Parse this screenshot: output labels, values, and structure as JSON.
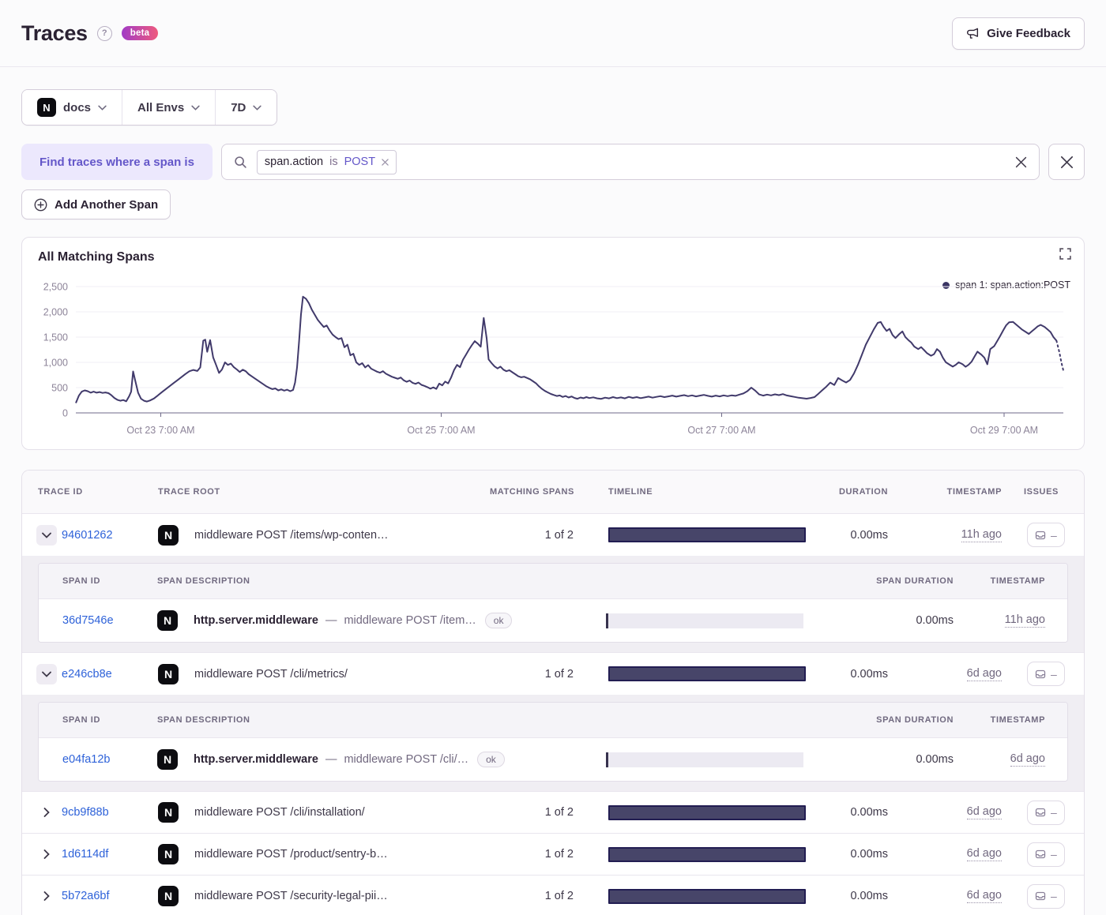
{
  "header": {
    "title": "Traces",
    "help_glyph": "?",
    "beta_label": "beta",
    "feedback_label": "Give Feedback"
  },
  "filters": {
    "project": "docs",
    "env": "All Envs",
    "period": "7D"
  },
  "brand": {
    "project_icon_letter": "N"
  },
  "search": {
    "label": "Find traces where a span is",
    "token_key": "span.action",
    "token_op": "is",
    "token_value": "POST"
  },
  "actions": {
    "add_span_label": "Add Another Span"
  },
  "chart": {
    "title": "All Matching Spans",
    "legend": "span 1: span.action:POST"
  },
  "chart_data": {
    "type": "line",
    "title": "All Matching Spans",
    "series_name": "span 1: span.action:POST",
    "line_color": "#413a6b",
    "ylim": [
      0,
      2500
    ],
    "grid": true,
    "legend_position": "top-right",
    "yticks": [
      {
        "v": 0,
        "label": "0"
      },
      {
        "v": 500,
        "label": "500"
      },
      {
        "v": 1000,
        "label": "1,000"
      },
      {
        "v": 1500,
        "label": "1,500"
      },
      {
        "v": 2000,
        "label": "2,000"
      },
      {
        "v": 2500,
        "label": "2,500"
      }
    ],
    "xticks": [
      {
        "pos": 0.086,
        "label": "Oct 23 7:00 AM"
      },
      {
        "pos": 0.37,
        "label": "Oct 25 7:00 AM"
      },
      {
        "pos": 0.654,
        "label": "Oct 27 7:00 AM"
      },
      {
        "pos": 0.94,
        "label": "Oct 29 7:00 AM"
      }
    ],
    "points": [
      [
        0.0,
        195
      ],
      [
        0.003,
        340
      ],
      [
        0.006,
        420
      ],
      [
        0.009,
        445
      ],
      [
        0.012,
        430
      ],
      [
        0.015,
        400
      ],
      [
        0.018,
        420
      ],
      [
        0.021,
        400
      ],
      [
        0.024,
        412
      ],
      [
        0.027,
        395
      ],
      [
        0.03,
        405
      ],
      [
        0.033,
        390
      ],
      [
        0.036,
        350
      ],
      [
        0.039,
        295
      ],
      [
        0.042,
        260
      ],
      [
        0.045,
        240
      ],
      [
        0.048,
        255
      ],
      [
        0.051,
        230
      ],
      [
        0.054,
        330
      ],
      [
        0.056,
        420
      ],
      [
        0.058,
        820
      ],
      [
        0.06,
        650
      ],
      [
        0.063,
        400
      ],
      [
        0.066,
        280
      ],
      [
        0.069,
        240
      ],
      [
        0.072,
        225
      ],
      [
        0.075,
        245
      ],
      [
        0.079,
        285
      ],
      [
        0.083,
        345
      ],
      [
        0.087,
        410
      ],
      [
        0.091,
        470
      ],
      [
        0.095,
        530
      ],
      [
        0.099,
        590
      ],
      [
        0.103,
        650
      ],
      [
        0.107,
        710
      ],
      [
        0.111,
        770
      ],
      [
        0.115,
        825
      ],
      [
        0.119,
        850
      ],
      [
        0.123,
        830
      ],
      [
        0.126,
        900
      ],
      [
        0.129,
        1430
      ],
      [
        0.131,
        1450
      ],
      [
        0.133,
        1210
      ],
      [
        0.136,
        1440
      ],
      [
        0.139,
        1100
      ],
      [
        0.142,
        950
      ],
      [
        0.145,
        790
      ],
      [
        0.148,
        860
      ],
      [
        0.151,
        1000
      ],
      [
        0.154,
        950
      ],
      [
        0.157,
        975
      ],
      [
        0.16,
        905
      ],
      [
        0.163,
        860
      ],
      [
        0.166,
        810
      ],
      [
        0.169,
        855
      ],
      [
        0.172,
        825
      ],
      [
        0.175,
        765
      ],
      [
        0.178,
        725
      ],
      [
        0.181,
        685
      ],
      [
        0.184,
        645
      ],
      [
        0.187,
        605
      ],
      [
        0.19,
        565
      ],
      [
        0.193,
        525
      ],
      [
        0.196,
        495
      ],
      [
        0.199,
        470
      ],
      [
        0.202,
        485
      ],
      [
        0.205,
        445
      ],
      [
        0.208,
        465
      ],
      [
        0.211,
        440
      ],
      [
        0.214,
        460
      ],
      [
        0.217,
        430
      ],
      [
        0.22,
        455
      ],
      [
        0.222,
        600
      ],
      [
        0.224,
        900
      ],
      [
        0.226,
        1400
      ],
      [
        0.228,
        1950
      ],
      [
        0.23,
        2300
      ],
      [
        0.233,
        2260
      ],
      [
        0.236,
        2170
      ],
      [
        0.239,
        2040
      ],
      [
        0.242,
        1940
      ],
      [
        0.245,
        1840
      ],
      [
        0.248,
        1770
      ],
      [
        0.251,
        1700
      ],
      [
        0.254,
        1730
      ],
      [
        0.257,
        1630
      ],
      [
        0.26,
        1550
      ],
      [
        0.263,
        1500
      ],
      [
        0.266,
        1460
      ],
      [
        0.269,
        1480
      ],
      [
        0.272,
        1300
      ],
      [
        0.275,
        1350
      ],
      [
        0.278,
        1140
      ],
      [
        0.281,
        1170
      ],
      [
        0.284,
        1000
      ],
      [
        0.287,
        950
      ],
      [
        0.29,
        985
      ],
      [
        0.293,
        900
      ],
      [
        0.296,
        945
      ],
      [
        0.299,
        875
      ],
      [
        0.302,
        845
      ],
      [
        0.305,
        815
      ],
      [
        0.308,
        795
      ],
      [
        0.311,
        825
      ],
      [
        0.314,
        775
      ],
      [
        0.317,
        745
      ],
      [
        0.32,
        715
      ],
      [
        0.323,
        695
      ],
      [
        0.326,
        675
      ],
      [
        0.329,
        700
      ],
      [
        0.332,
        645
      ],
      [
        0.335,
        615
      ],
      [
        0.338,
        640
      ],
      [
        0.341,
        595
      ],
      [
        0.344,
        575
      ],
      [
        0.347,
        600
      ],
      [
        0.35,
        555
      ],
      [
        0.353,
        535
      ],
      [
        0.356,
        510
      ],
      [
        0.359,
        480
      ],
      [
        0.362,
        505
      ],
      [
        0.365,
        475
      ],
      [
        0.368,
        580
      ],
      [
        0.371,
        545
      ],
      [
        0.374,
        620
      ],
      [
        0.377,
        585
      ],
      [
        0.38,
        700
      ],
      [
        0.383,
        850
      ],
      [
        0.386,
        950
      ],
      [
        0.389,
        905
      ],
      [
        0.392,
        1050
      ],
      [
        0.395,
        1150
      ],
      [
        0.398,
        1250
      ],
      [
        0.401,
        1340
      ],
      [
        0.404,
        1420
      ],
      [
        0.407,
        1370
      ],
      [
        0.41,
        1310
      ],
      [
        0.413,
        1880
      ],
      [
        0.416,
        1480
      ],
      [
        0.418,
        1060
      ],
      [
        0.421,
        985
      ],
      [
        0.424,
        920
      ],
      [
        0.427,
        880
      ],
      [
        0.43,
        915
      ],
      [
        0.433,
        855
      ],
      [
        0.436,
        825
      ],
      [
        0.439,
        845
      ],
      [
        0.442,
        805
      ],
      [
        0.445,
        765
      ],
      [
        0.448,
        725
      ],
      [
        0.451,
        705
      ],
      [
        0.454,
        715
      ],
      [
        0.457,
        690
      ],
      [
        0.46,
        665
      ],
      [
        0.463,
        625
      ],
      [
        0.466,
        585
      ],
      [
        0.469,
        525
      ],
      [
        0.472,
        475
      ],
      [
        0.475,
        435
      ],
      [
        0.478,
        405
      ],
      [
        0.481,
        375
      ],
      [
        0.484,
        355
      ],
      [
        0.487,
        335
      ],
      [
        0.49,
        345
      ],
      [
        0.493,
        315
      ],
      [
        0.496,
        335
      ],
      [
        0.499,
        305
      ],
      [
        0.502,
        325
      ],
      [
        0.505,
        295
      ],
      [
        0.508,
        280
      ],
      [
        0.511,
        305
      ],
      [
        0.514,
        290
      ],
      [
        0.517,
        312
      ],
      [
        0.52,
        293
      ],
      [
        0.524,
        308
      ],
      [
        0.528,
        288
      ],
      [
        0.532,
        278
      ],
      [
        0.536,
        302
      ],
      [
        0.54,
        287
      ],
      [
        0.544,
        312
      ],
      [
        0.548,
        292
      ],
      [
        0.552,
        307
      ],
      [
        0.556,
        287
      ],
      [
        0.56,
        317
      ],
      [
        0.564,
        297
      ],
      [
        0.568,
        312
      ],
      [
        0.572,
        292
      ],
      [
        0.576,
        307
      ],
      [
        0.58,
        322
      ],
      [
        0.584,
        302
      ],
      [
        0.588,
        317
      ],
      [
        0.592,
        332
      ],
      [
        0.596,
        312
      ],
      [
        0.6,
        327
      ],
      [
        0.604,
        342
      ],
      [
        0.608,
        322
      ],
      [
        0.612,
        337
      ],
      [
        0.616,
        352
      ],
      [
        0.62,
        332
      ],
      [
        0.624,
        347
      ],
      [
        0.628,
        327
      ],
      [
        0.632,
        342
      ],
      [
        0.636,
        357
      ],
      [
        0.64,
        337
      ],
      [
        0.644,
        322
      ],
      [
        0.648,
        342
      ],
      [
        0.652,
        327
      ],
      [
        0.656,
        347
      ],
      [
        0.66,
        332
      ],
      [
        0.664,
        347
      ],
      [
        0.668,
        337
      ],
      [
        0.672,
        362
      ],
      [
        0.676,
        385
      ],
      [
        0.68,
        430
      ],
      [
        0.684,
        500
      ],
      [
        0.688,
        440
      ],
      [
        0.692,
        365
      ],
      [
        0.696,
        342
      ],
      [
        0.7,
        362
      ],
      [
        0.704,
        347
      ],
      [
        0.708,
        367
      ],
      [
        0.712,
        352
      ],
      [
        0.716,
        372
      ],
      [
        0.72,
        345
      ],
      [
        0.724,
        330
      ],
      [
        0.728,
        315
      ],
      [
        0.732,
        300
      ],
      [
        0.736,
        290
      ],
      [
        0.74,
        282
      ],
      [
        0.744,
        295
      ],
      [
        0.748,
        312
      ],
      [
        0.752,
        380
      ],
      [
        0.756,
        452
      ],
      [
        0.76,
        520
      ],
      [
        0.764,
        600
      ],
      [
        0.768,
        552
      ],
      [
        0.772,
        690
      ],
      [
        0.776,
        642
      ],
      [
        0.78,
        602
      ],
      [
        0.784,
        652
      ],
      [
        0.788,
        782
      ],
      [
        0.792,
        952
      ],
      [
        0.796,
        1150
      ],
      [
        0.8,
        1352
      ],
      [
        0.804,
        1502
      ],
      [
        0.808,
        1652
      ],
      [
        0.812,
        1782
      ],
      [
        0.815,
        1800
      ],
      [
        0.818,
        1702
      ],
      [
        0.821,
        1622
      ],
      [
        0.824,
        1662
      ],
      [
        0.827,
        1542
      ],
      [
        0.83,
        1482
      ],
      [
        0.834,
        1562
      ],
      [
        0.837,
        1612
      ],
      [
        0.84,
        1502
      ],
      [
        0.843,
        1442
      ],
      [
        0.846,
        1392
      ],
      [
        0.849,
        1312
      ],
      [
        0.853,
        1262
      ],
      [
        0.856,
        1302
      ],
      [
        0.859,
        1242
      ],
      [
        0.862,
        1182
      ],
      [
        0.866,
        1132
      ],
      [
        0.869,
        1162
      ],
      [
        0.872,
        1262
      ],
      [
        0.875,
        1212
      ],
      [
        0.878,
        1092
      ],
      [
        0.881,
        1002
      ],
      [
        0.885,
        952
      ],
      [
        0.888,
        915
      ],
      [
        0.891,
        952
      ],
      [
        0.894,
        1002
      ],
      [
        0.898,
        962
      ],
      [
        0.901,
        912
      ],
      [
        0.904,
        952
      ],
      [
        0.907,
        1012
      ],
      [
        0.91,
        1112
      ],
      [
        0.913,
        1212
      ],
      [
        0.917,
        1152
      ],
      [
        0.92,
        1092
      ],
      [
        0.923,
        962
      ],
      [
        0.926,
        1262
      ],
      [
        0.93,
        1322
      ],
      [
        0.933,
        1422
      ],
      [
        0.936,
        1522
      ],
      [
        0.939,
        1632
      ],
      [
        0.942,
        1732
      ],
      [
        0.945,
        1792
      ],
      [
        0.949,
        1802
      ],
      [
        0.952,
        1752
      ],
      [
        0.955,
        1702
      ],
      [
        0.958,
        1652
      ],
      [
        0.962,
        1602
      ],
      [
        0.965,
        1562
      ],
      [
        0.968,
        1612
      ],
      [
        0.971,
        1662
      ],
      [
        0.974,
        1712
      ],
      [
        0.977,
        1742
      ],
      [
        0.981,
        1702
      ],
      [
        0.984,
        1652
      ],
      [
        0.987,
        1600
      ],
      [
        0.99,
        1500
      ],
      [
        0.993,
        1430
      ],
      [
        0.996,
        1200
      ],
      [
        0.998,
        1000
      ],
      [
        1.0,
        840
      ]
    ]
  },
  "table": {
    "dash": "—",
    "issues_dash": "–",
    "columns": {
      "trace_id": "TRACE ID",
      "trace_root": "TRACE ROOT",
      "matching_spans": "MATCHING SPANS",
      "timeline": "TIMELINE",
      "duration": "DURATION",
      "timestamp": "TIMESTAMP",
      "issues": "ISSUES"
    },
    "span_columns": {
      "span_id": "SPAN ID",
      "span_description": "SPAN DESCRIPTION",
      "span_duration": "SPAN DURATION",
      "timestamp": "TIMESTAMP"
    },
    "rows": [
      {
        "id": "94601262",
        "root": "middleware POST /items/wp-conten…",
        "matching": "1 of 2",
        "duration": "0.00ms",
        "timestamp": "11h ago",
        "span": {
          "id": "36d7546e",
          "op": "http.server.middleware",
          "desc": "middleware POST /item…",
          "status": "ok",
          "duration": "0.00ms",
          "timestamp": "11h ago"
        }
      },
      {
        "id": "e246cb8e",
        "root": "middleware POST /cli/metrics/",
        "matching": "1 of 2",
        "duration": "0.00ms",
        "timestamp": "6d ago",
        "span": {
          "id": "e04fa12b",
          "op": "http.server.middleware",
          "desc": "middleware POST /cli/…",
          "status": "ok",
          "duration": "0.00ms",
          "timestamp": "6d ago"
        }
      },
      {
        "id": "9cb9f88b",
        "root": "middleware POST /cli/installation/",
        "matching": "1 of 2",
        "duration": "0.00ms",
        "timestamp": "6d ago"
      },
      {
        "id": "1d6114df",
        "root": "middleware POST /product/sentry-b…",
        "matching": "1 of 2",
        "duration": "0.00ms",
        "timestamp": "6d ago"
      },
      {
        "id": "5b72a6bf",
        "root": "middleware POST /security-legal-pii…",
        "matching": "1 of 2",
        "duration": "0.00ms",
        "timestamp": "6d ago"
      }
    ]
  }
}
